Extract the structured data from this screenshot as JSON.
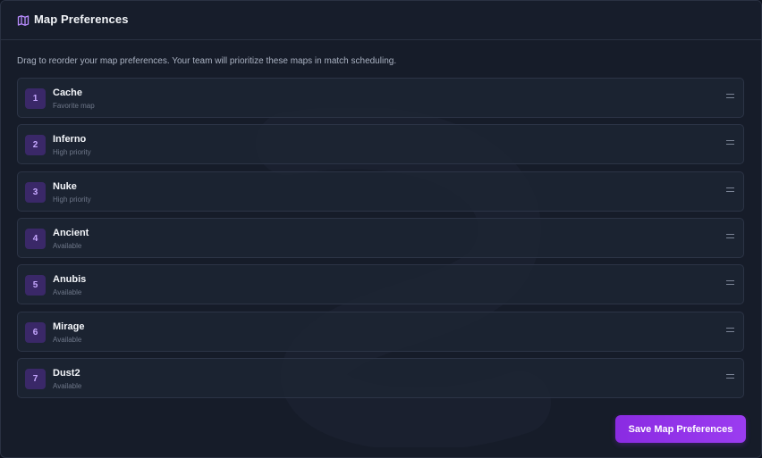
{
  "header": {
    "title": "Map Preferences",
    "icon": "map-icon"
  },
  "instructions": "Drag to reorder your map preferences. Your team will prioritize these maps in match scheduling.",
  "maps": [
    {
      "rank": "1",
      "name": "Cache",
      "status": "Favorite map"
    },
    {
      "rank": "2",
      "name": "Inferno",
      "status": "High priority"
    },
    {
      "rank": "3",
      "name": "Nuke",
      "status": "High priority"
    },
    {
      "rank": "4",
      "name": "Ancient",
      "status": "Available"
    },
    {
      "rank": "5",
      "name": "Anubis",
      "status": "Available"
    },
    {
      "rank": "6",
      "name": "Mirage",
      "status": "Available"
    },
    {
      "rank": "7",
      "name": "Dust2",
      "status": "Available"
    }
  ],
  "save_button": "Save Map Preferences",
  "colors": {
    "accent": "#8a2be2",
    "rank_badge": "#3a2868",
    "background": "#161c29"
  }
}
